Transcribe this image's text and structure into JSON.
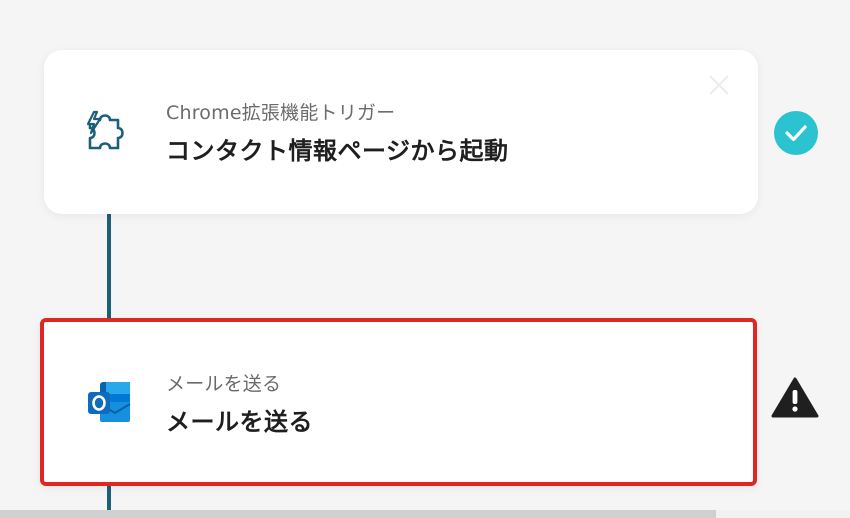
{
  "steps": [
    {
      "subtitle": "Chrome拡張機能トリガー",
      "title": "コンタクト情報ページから起動",
      "icon": "puzzle-lightning-icon",
      "status": "check-icon",
      "status_color": "#2bc3cf"
    },
    {
      "subtitle": "メールを送る",
      "title": "メールを送る",
      "icon": "outlook-icon",
      "status": "warning-icon",
      "highlight_color": "#e02525"
    }
  ],
  "colors": {
    "connector": "#1b5f7a",
    "background": "#f5f5f5",
    "card": "#ffffff"
  }
}
